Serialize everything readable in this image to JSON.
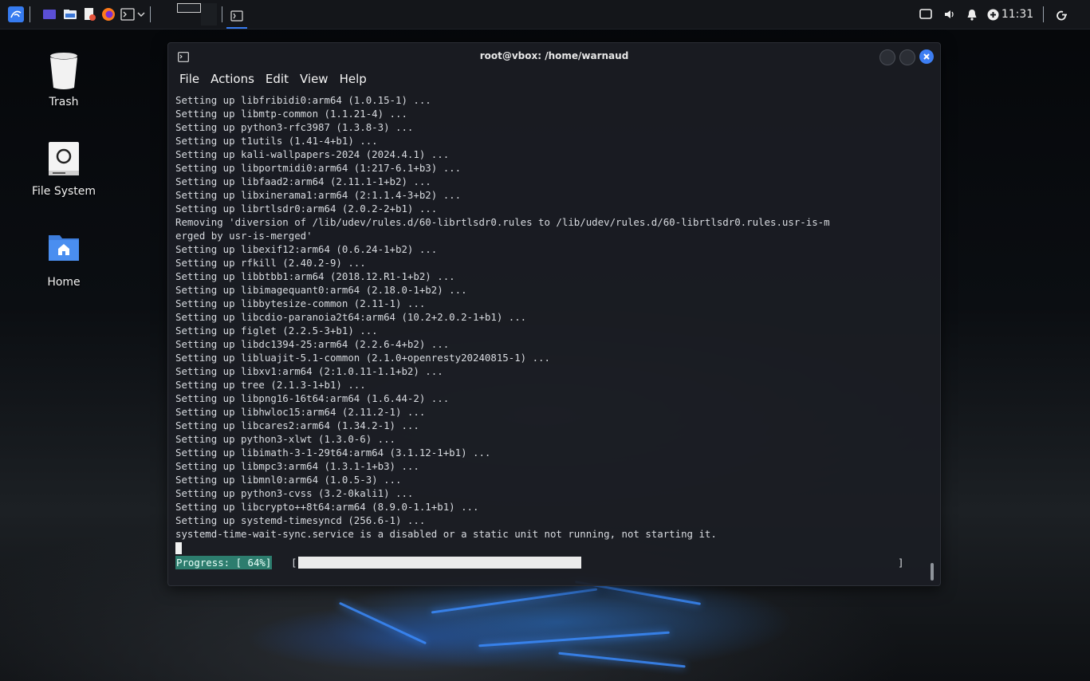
{
  "taskbar": {
    "launchers": [
      "kali-menu-icon",
      "show-desktop-icon",
      "file-manager-icon",
      "text-editor-icon",
      "firefox-icon",
      "terminal-icon",
      "terminal-dropdown-icon"
    ],
    "clock": "11:31",
    "tray": [
      "display-icon",
      "volume-icon",
      "notification-bell-icon",
      "update-icon",
      "power-icon"
    ]
  },
  "desktop": {
    "icons": [
      {
        "label": "Trash",
        "icon": "trash-icon"
      },
      {
        "label": "File System",
        "icon": "drive-icon"
      },
      {
        "label": "Home",
        "icon": "home-folder-icon"
      }
    ]
  },
  "terminal": {
    "title": "root@vbox: /home/warnaud",
    "menu": [
      "File",
      "Actions",
      "Edit",
      "View",
      "Help"
    ],
    "lines": [
      "Setting up libfribidi0:arm64 (1.0.15-1) ...",
      "Setting up libmtp-common (1.1.21-4) ...",
      "Setting up python3-rfc3987 (1.3.8-3) ...",
      "Setting up t1utils (1.41-4+b1) ...",
      "Setting up kali-wallpapers-2024 (2024.4.1) ...",
      "Setting up libportmidi0:arm64 (1:217-6.1+b3) ...",
      "Setting up libfaad2:arm64 (2.11.1-1+b2) ...",
      "Setting up libxinerama1:arm64 (2:1.1.4-3+b2) ...",
      "Setting up librtlsdr0:arm64 (2.0.2-2+b1) ...",
      "Removing 'diversion of /lib/udev/rules.d/60-librtlsdr0.rules to /lib/udev/rules.d/60-librtlsdr0.rules.usr-is-m",
      "erged by usr-is-merged'",
      "Setting up libexif12:arm64 (0.6.24-1+b2) ...",
      "Setting up rfkill (2.40.2-9) ...",
      "Setting up libbtbb1:arm64 (2018.12.R1-1+b2) ...",
      "Setting up libimagequant0:arm64 (2.18.0-1+b2) ...",
      "Setting up libbytesize-common (2.11-1) ...",
      "Setting up libcdio-paranoia2t64:arm64 (10.2+2.0.2-1+b1) ...",
      "Setting up figlet (2.2.5-3+b1) ...",
      "Setting up libdc1394-25:arm64 (2.2.6-4+b2) ...",
      "Setting up libluajit-5.1-common (2.1.0+openresty20240815-1) ...",
      "Setting up libxv1:arm64 (2:1.0.11-1.1+b2) ...",
      "Setting up tree (2.1.3-1+b1) ...",
      "Setting up libpng16-16t64:arm64 (1.6.44-2) ...",
      "Setting up libhwloc15:arm64 (2.11.2-1) ...",
      "Setting up libcares2:arm64 (1.34.2-1) ...",
      "Setting up python3-xlwt (1.3.0-6) ...",
      "Setting up libimath-3-1-29t64:arm64 (3.1.12-1+b1) ...",
      "Setting up libmpc3:arm64 (1.3.1-1+b3) ...",
      "Setting up libmnl0:arm64 (1.0.5-3) ...",
      "Setting up python3-cvss (3.2-0kali1) ...",
      "Setting up libcrypto++8t64:arm64 (8.9.0-1.1+b1) ...",
      "Setting up systemd-timesyncd (256.6-1) ...",
      "systemd-time-wait-sync.service is a disabled or a static unit not running, not starting it."
    ],
    "progress": {
      "label": "Progress: [ 64%]",
      "open_bracket": "[",
      "close_bracket": "]",
      "fraction": 0.64
    }
  },
  "colors": {
    "accent": "#367bf0",
    "progress_label_bg": "#2d7d6e",
    "terminal_bg": "#1b1d24"
  }
}
